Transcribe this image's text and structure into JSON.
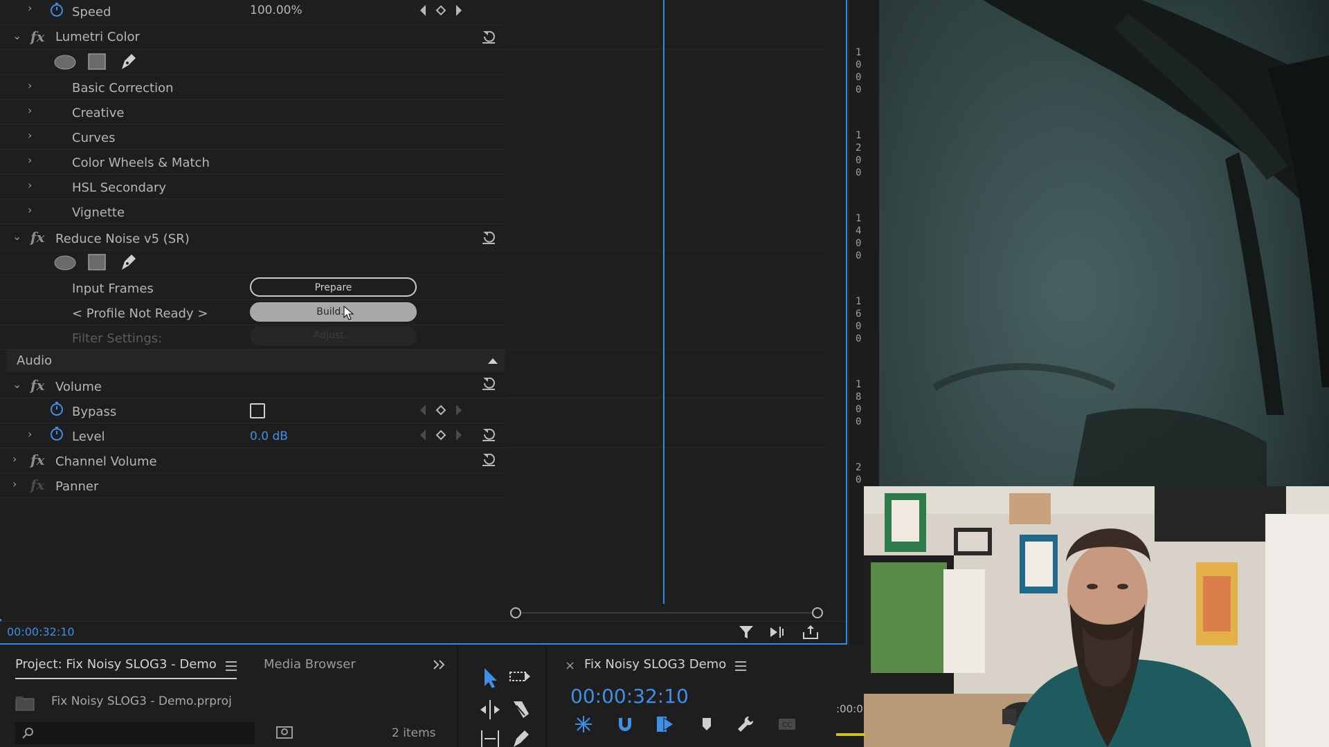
{
  "effects": {
    "speed": {
      "label": "Speed",
      "value": "100.00%"
    },
    "lumetri": {
      "name": "Lumetri Color",
      "sections": [
        "Basic Correction",
        "Creative",
        "Curves",
        "Color Wheels & Match",
        "HSL Secondary",
        "Vignette"
      ]
    },
    "reduce_noise": {
      "name": "Reduce Noise v5 (SR)",
      "input_frames_label": "Input Frames",
      "prepare_label": "Prepare",
      "profile_label": "< Profile Not Ready >",
      "build_label": "Build...",
      "filter_label": "Filter Settings:",
      "adjust_label": "Adjust..."
    },
    "audio_header": "Audio",
    "volume": {
      "name": "Volume",
      "bypass_label": "Bypass",
      "level_label": "Level",
      "level_value": "0.0 dB"
    },
    "channel_volume": {
      "name": "Channel Volume"
    },
    "panner": {
      "name": "Panner"
    },
    "footer_timecode": "00:00:32:10"
  },
  "ruler": {
    "digits": [
      "1",
      "0",
      "0",
      "0",
      "1",
      "2",
      "0",
      "0",
      "1",
      "4",
      "0",
      "0",
      "1",
      "6",
      "0",
      "0",
      "1",
      "8",
      "0",
      "0",
      "2",
      "0"
    ]
  },
  "project": {
    "tab_title": "Project: Fix Noisy SLOG3 - Demo",
    "media_browser_tab": "Media Browser",
    "overflow_icon": "double-chevron-right",
    "file_name": "Fix Noisy SLOG3 - Demo.prproj",
    "item_count": "2 items"
  },
  "timeline": {
    "close_glyph": "×",
    "sequence_name": "Fix Noisy SLOG3 Demo",
    "timecode": "00:00:32:10",
    "ruler_text": ":00:0"
  },
  "colors": {
    "accent": "#2d8ceb",
    "timecode_blue": "#3f8fe6",
    "panel_bg": "#1e1e1e"
  }
}
